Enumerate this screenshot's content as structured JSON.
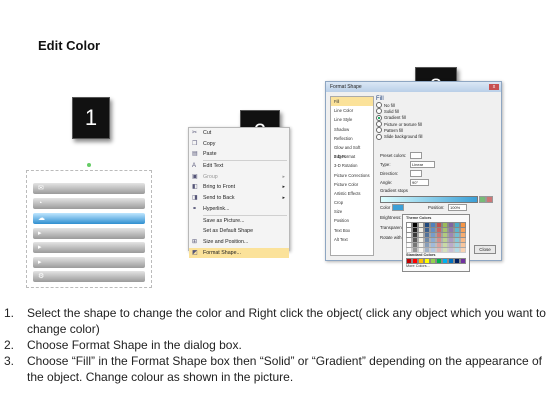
{
  "title": "Edit Color",
  "steps": {
    "one": "1",
    "two": "2",
    "three": "3"
  },
  "context_menu": {
    "items": [
      {
        "label": "Cut",
        "icon": "scissors-icon"
      },
      {
        "label": "Copy",
        "icon": "copy-icon"
      },
      {
        "label": "Paste",
        "icon": "paste-icon"
      },
      {
        "label": "Edit Text",
        "icon": "edit-text-icon"
      },
      {
        "label": "Group",
        "icon": "group-icon"
      },
      {
        "label": "Bring to Front",
        "icon": "bring-front-icon"
      },
      {
        "label": "Send to Back",
        "icon": "send-back-icon"
      },
      {
        "label": "Hyperlink...",
        "icon": "hyperlink-icon"
      },
      {
        "label": "Save as Picture...",
        "icon": ""
      },
      {
        "label": "Set as Default Shape",
        "icon": ""
      },
      {
        "label": "Size and Position...",
        "icon": "size-icon"
      },
      {
        "label": "Format Shape...",
        "icon": "format-shape-icon"
      }
    ]
  },
  "dialog": {
    "title": "Format Shape",
    "close_glyph": "x",
    "nav": [
      "Fill",
      "Line Color",
      "Line Style",
      "Shadow",
      "Reflection",
      "Glow and Soft Edges",
      "3-D Format",
      "3-D Rotation",
      "Picture Corrections",
      "Picture Color",
      "Artistic Effects",
      "Crop",
      "Size",
      "Position",
      "Text Box",
      "Alt Text"
    ],
    "section": "Fill",
    "fill_options": [
      "No fill",
      "Solid fill",
      "Gradient fill",
      "Picture or texture fill",
      "Pattern fill",
      "Slide background fill"
    ],
    "preset_colors": "Preset colors:",
    "type_label": "Type:",
    "type_value": "Linear",
    "direction_label": "Direction:",
    "angle_label": "Angle:",
    "angle_value": "90°",
    "gradient_stops": "Gradient stops",
    "color_label": "Color",
    "position_label": "Position:",
    "position_value": "100%",
    "brightness_label": "Brightness:",
    "transparency_label": "Transparency:",
    "rotate_label": "Rotate with shape",
    "close_button": "Close",
    "theme_colors": "Theme Colors",
    "standard_colors": "Standard Colors",
    "more_colors": "More Colors..."
  },
  "instructions": [
    {
      "num": "1.",
      "text": "Select the shape to change the color and Right click the object( click any object which you want to change color)"
    },
    {
      "num": "2.",
      "text": "Choose Format Shape in the dialog box."
    },
    {
      "num": "3.",
      "text": "Choose “Fill” in the Format Shape box then “Solid” or “Gradient” depending on the appearance of the object. Change colour as shown in the picture."
    }
  ]
}
